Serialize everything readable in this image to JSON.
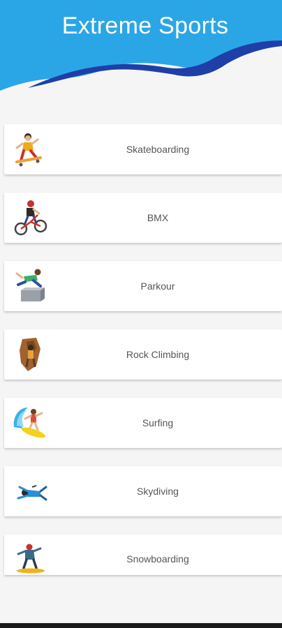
{
  "app": {
    "title": "Extreme Sports",
    "colors": {
      "header_light": "#2aa6e6",
      "header_dark": "#1f3fa8",
      "background": "#f5f5f5",
      "card": "#ffffff",
      "text": "#555555"
    }
  },
  "sports": [
    {
      "label": "Skateboarding",
      "icon": "skateboarder-icon"
    },
    {
      "label": "BMX",
      "icon": "bmx-rider-icon"
    },
    {
      "label": "Parkour",
      "icon": "parkour-icon"
    },
    {
      "label": "Rock Climbing",
      "icon": "rock-climber-icon"
    },
    {
      "label": "Surfing",
      "icon": "surfer-icon"
    },
    {
      "label": "Skydiving",
      "icon": "skydiver-icon"
    },
    {
      "label": "Snowboarding",
      "icon": "snowboarder-icon"
    }
  ]
}
